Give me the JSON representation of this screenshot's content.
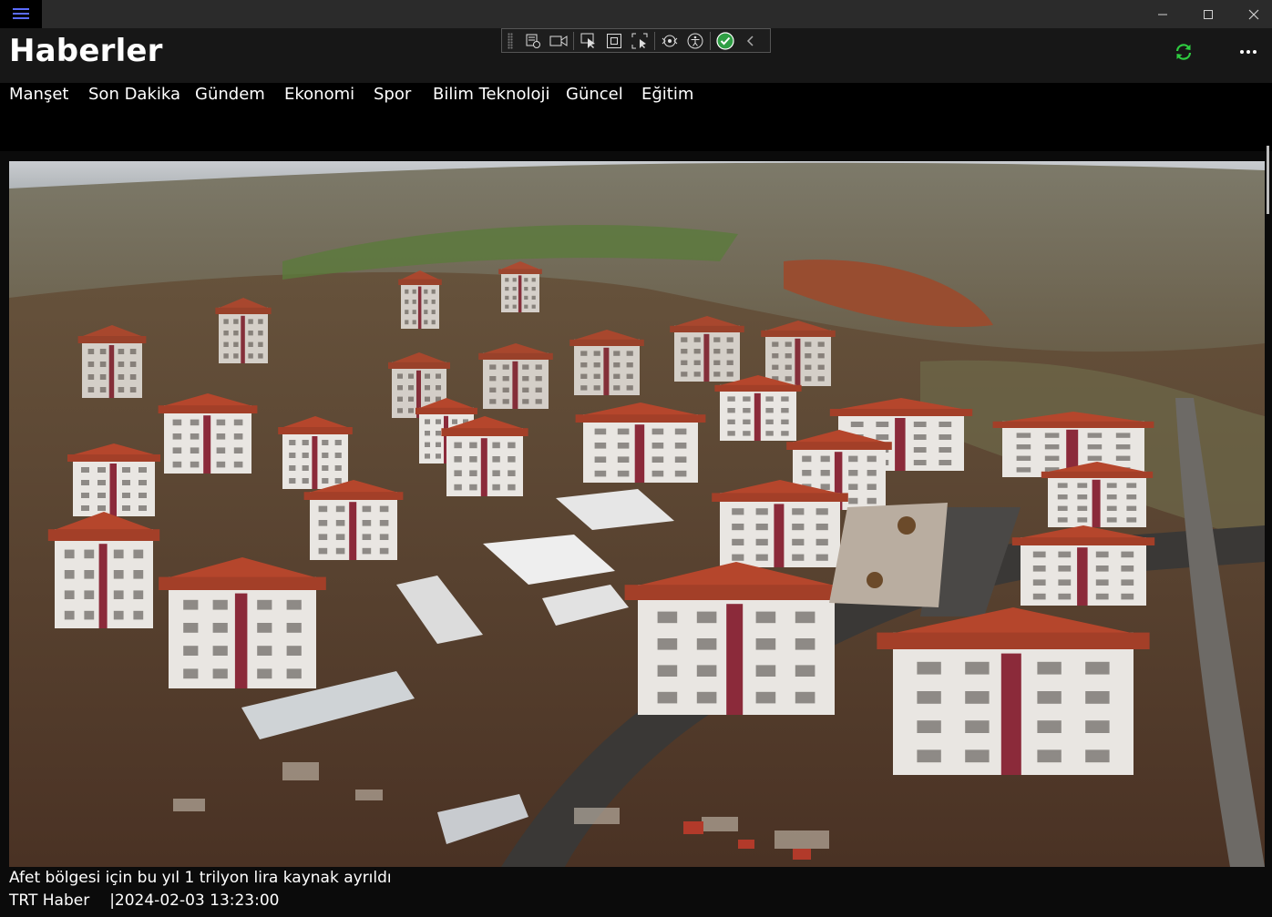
{
  "app": {
    "title": "Haberler"
  },
  "nav": {
    "items": [
      "Manşet",
      "Son Dakika",
      "Gündem",
      "Ekonomi",
      "Spor",
      "Bilim Teknoloji",
      "Güncel",
      "Eğitim"
    ]
  },
  "article": {
    "headline": "Afet bölgesi için bu yıl 1 trilyon lira kaynak ayrıldı",
    "source": "TRT Haber",
    "separator": "|",
    "date": "2024-02-03 13:23:00"
  },
  "colors": {
    "accent_menu": "#5b6cff",
    "refresh": "#2ecc40",
    "header_bg": "#171717",
    "titlebar_bg": "#2b2b2b"
  },
  "icons": {
    "menu": "hamburger-icon",
    "refresh": "refresh-icon",
    "more": "more-icon",
    "minimize": "minimize-icon",
    "maximize": "maximize-icon",
    "close": "close-icon"
  }
}
